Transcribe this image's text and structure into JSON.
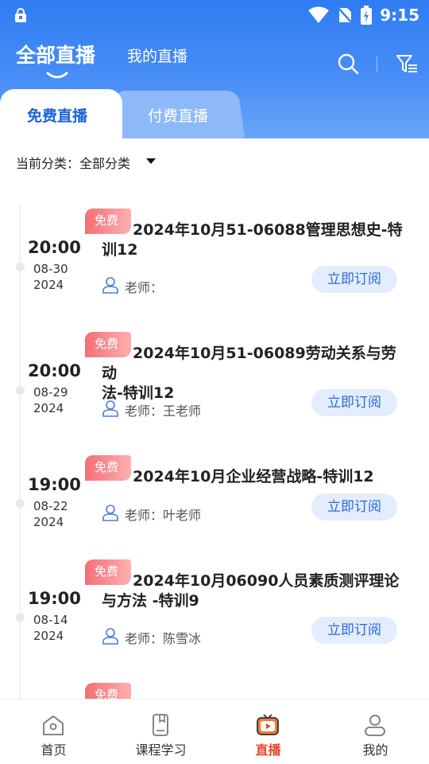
{
  "status": {
    "time": "9:15"
  },
  "topnav": {
    "all_live": "全部直播",
    "my_live": "我的直播"
  },
  "tabs": {
    "free": "免费直播",
    "paid": "付费直播"
  },
  "category": {
    "label": "当前分类：",
    "value": "全部分类"
  },
  "items": [
    {
      "time": "20:00",
      "date": "08-30",
      "year": "2024",
      "badge": "免费",
      "title_line1": "2024年10月51-06088管理思想史-特",
      "title_line2": "训12",
      "teacher": "老师：",
      "action": "立即订阅"
    },
    {
      "time": "20:00",
      "date": "08-29",
      "year": "2024",
      "badge": "免费",
      "title_line1": "2024年10月51-06089劳动关系与劳动",
      "title_line2": "法-特训12",
      "teacher": "老师：王老师",
      "action": "立即订阅"
    },
    {
      "time": "19:00",
      "date": "08-22",
      "year": "2024",
      "badge": "免费",
      "title_line1": "2024年10月企业经营战略-特训12",
      "title_line2": "",
      "teacher": "老师：叶老师",
      "action": "立即订阅"
    },
    {
      "time": "19:00",
      "date": "08-14",
      "year": "2024",
      "badge": "免费",
      "title_line1": "2024年10月06090人员素质测评理论",
      "title_line2": "与方法 -特训9",
      "teacher": "老师：陈雪冰",
      "action": "立即订阅"
    },
    {
      "badge": "免费"
    }
  ],
  "bottomnav": {
    "home": "首页",
    "courses": "课程学习",
    "live": "直播",
    "mine": "我的"
  },
  "colors": {
    "primary": "#2f7cf3",
    "badge": "#f46f77",
    "active_nav": "#e8462b"
  }
}
